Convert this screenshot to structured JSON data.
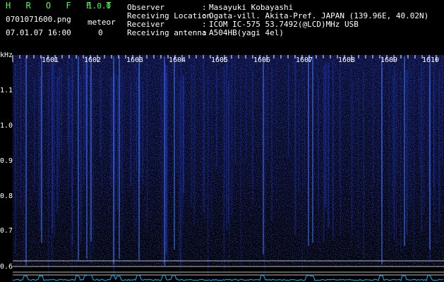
{
  "app": {
    "name": "H R O F F T",
    "version": "1.0.0"
  },
  "file": {
    "name": "0701071600.png",
    "datetime": "07.01.07 16:00"
  },
  "meteor": {
    "label": "meteor",
    "count": "0"
  },
  "info": [
    {
      "label": "Observer",
      "value": "Masayuki Kobayashi"
    },
    {
      "label": "Receiving Location",
      "value": "Ogata-vill. Akita-Pref. JAPAN (139.96E, 40.02N)"
    },
    {
      "label": "Receiver",
      "value": "ICOM IC-575 53.7492(@LCD)MHz USB"
    },
    {
      "label": "Receiving antenna",
      "value": "A504HB(yagi 4el)"
    }
  ],
  "axis": {
    "y_unit": "kHz",
    "y_ticks": [
      "1.1",
      "1.0",
      "0.9",
      "0.8",
      "0.7",
      "0.6"
    ],
    "x_ticks": [
      "1601",
      "1602",
      "1603",
      "1604",
      "1605",
      "1606",
      "1607",
      "1608",
      "1609",
      "1610"
    ]
  },
  "colors": {
    "background": "#000000",
    "signal": "#2a3cff",
    "text_green": "#4cff4c",
    "trace": "#00b4ff"
  }
}
